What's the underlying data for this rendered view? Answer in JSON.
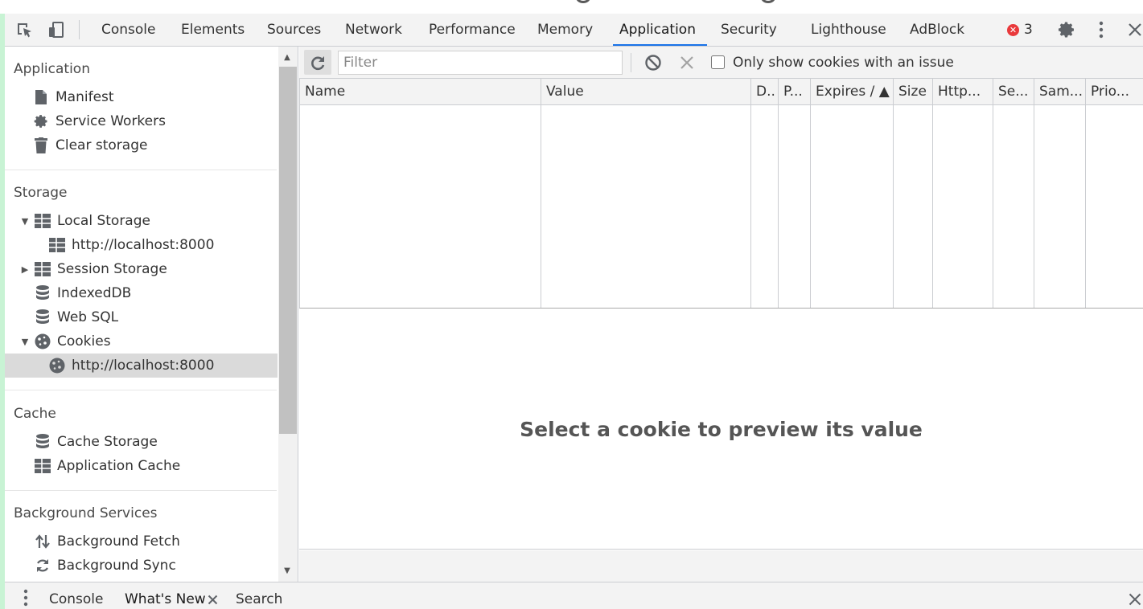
{
  "toolbar": {
    "tabs": [
      {
        "label": "Console"
      },
      {
        "label": "Elements"
      },
      {
        "label": "Sources"
      },
      {
        "label": "Network"
      },
      {
        "label": "Performance"
      },
      {
        "label": "Memory"
      },
      {
        "label": "Application",
        "selected": true
      },
      {
        "label": "Security"
      },
      {
        "label": "Lighthouse"
      },
      {
        "label": "AdBlock"
      }
    ],
    "error_count": "3",
    "accent_color": "#1a73e8",
    "error_color": "#e9393b"
  },
  "sidebar": {
    "application": {
      "heading": "Application",
      "items": [
        {
          "label": "Manifest",
          "icon": "document-icon"
        },
        {
          "label": "Service Workers",
          "icon": "gear-icon"
        },
        {
          "label": "Clear storage",
          "icon": "trash-icon"
        }
      ]
    },
    "storage": {
      "heading": "Storage",
      "items": [
        {
          "label": "Local Storage",
          "icon": "table-icon",
          "expanded": true
        },
        {
          "label": "http://localhost:8000",
          "icon": "table-icon"
        },
        {
          "label": "Session Storage",
          "icon": "table-icon",
          "expanded": false
        },
        {
          "label": "IndexedDB",
          "icon": "database-icon"
        },
        {
          "label": "Web SQL",
          "icon": "database-icon"
        },
        {
          "label": "Cookies",
          "icon": "cookie-icon",
          "expanded": true
        },
        {
          "label": "http://localhost:8000",
          "icon": "cookie-icon",
          "selected": true
        }
      ]
    },
    "cache": {
      "heading": "Cache",
      "items": [
        {
          "label": "Cache Storage",
          "icon": "database-icon"
        },
        {
          "label": "Application Cache",
          "icon": "table-icon"
        }
      ]
    },
    "background_services": {
      "heading": "Background Services",
      "items": [
        {
          "label": "Background Fetch",
          "icon": "up-down-arrows-icon"
        },
        {
          "label": "Background Sync",
          "icon": "sync-icon"
        }
      ]
    }
  },
  "cookies": {
    "filter_placeholder": "Filter",
    "issue_filter_label": "Only show cookies with an issue",
    "issue_filter_checked": false,
    "columns": [
      "Name",
      "Value",
      "D..",
      "P...",
      "Expires / ▲",
      "Size",
      "Http...",
      "Se...",
      "Sam...",
      "Prio..."
    ],
    "rows": [],
    "preview_message": "Select a cookie to preview its value"
  },
  "drawer": {
    "tabs": [
      {
        "label": "Console"
      },
      {
        "label": "What's New",
        "selected": true,
        "closable": true
      },
      {
        "label": "Search"
      }
    ]
  }
}
